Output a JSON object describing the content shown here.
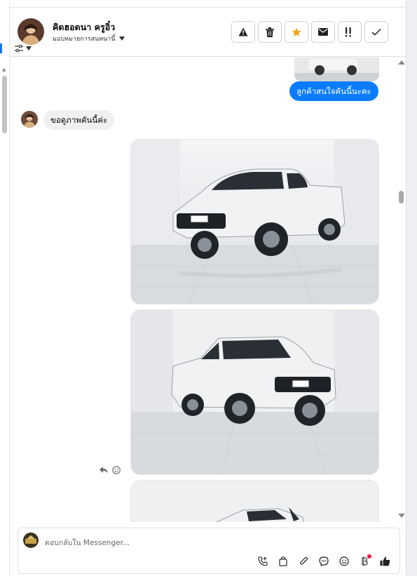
{
  "contact": {
    "name": "คิดฮอดนา ครูอิ๋ว",
    "assignee": "มอบหมายการสนทนานี้"
  },
  "toolbar": {
    "actions": [
      "warning-icon",
      "trash-icon",
      "star-icon",
      "envelope-icon",
      "important-icon",
      "check-icon"
    ],
    "star_color": "#f5a623"
  },
  "messages": {
    "outgoing_text": "ลูกค้าสนใจคันนี้นะคะ",
    "incoming_text": "ขอดูภาพคันนี้ค่ะ",
    "outgoing_color": "#0a7cff",
    "incoming_color": "#f0f0f0"
  },
  "composer": {
    "placeholder": "ตอบกลับใน Messenger...",
    "tools": [
      "call-plus-icon",
      "bag-icon",
      "paperclip-icon",
      "chat-bubble-icon",
      "emoji-icon",
      "bitcoin-icon",
      "like-icon"
    ]
  }
}
